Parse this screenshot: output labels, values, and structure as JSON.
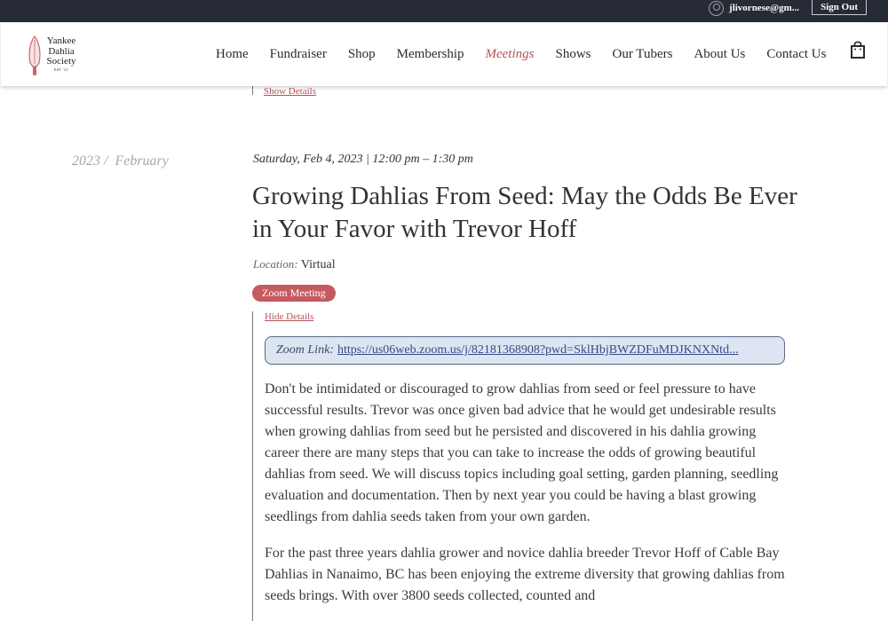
{
  "account": {
    "email": "jlivornese@gm...",
    "signout_label": "Sign Out"
  },
  "logo": {
    "line1": "Yankee",
    "line2": "Dahlia",
    "line3": "Society",
    "est": "EST '21"
  },
  "nav": {
    "items": [
      {
        "label": "Home"
      },
      {
        "label": "Fundraiser"
      },
      {
        "label": "Shop"
      },
      {
        "label": "Membership"
      },
      {
        "label": "Meetings",
        "active": true
      },
      {
        "label": "Shows"
      },
      {
        "label": "Our Tubers"
      },
      {
        "label": "About Us"
      },
      {
        "label": "Contact Us"
      }
    ]
  },
  "previous_event": {
    "show_details_label": "Show Details"
  },
  "event": {
    "side_year": "2023",
    "side_month": "February",
    "date_time": "Saturday, Feb 4, 2023 | 12:00 pm – 1:30 pm",
    "title": "Growing Dahlias From Seed: May the Odds Be Ever in Your Favor with Trevor Hoff",
    "location_label": "Location:",
    "location_value": "Virtual",
    "tag": "Zoom Meeting",
    "hide_details_label": "Hide Details",
    "zoom_label": "Zoom Link:",
    "zoom_url": "https://us06web.zoom.us/j/82181368908?pwd=SklHbjBWZDFuMDJKNXNtd...",
    "paragraph1": "Don't be intimidated or discouraged to grow dahlias from seed or feel pressure to have successful results. Trevor was once given bad advice that he would get undesirable results when growing dahlias from seed but he persisted and discovered in his dahlia growing career there are many steps that you can take to increase the odds of growing beautiful dahlias from seed. We will discuss topics including goal setting, garden planning, seedling evaluation and documentation. Then by next year you could be having a blast growing seedlings from dahlia seeds taken from your own garden.",
    "paragraph2": "For the past three years dahlia grower and novice dahlia breeder Trevor Hoff of Cable Bay Dahlias in Nanaimo, BC has been enjoying the extreme diversity that growing dahlias from seeds brings. With over 3800 seeds collected, counted and"
  },
  "colors": {
    "topbar": "#262b35",
    "accent": "#b4525a",
    "tag": "#c55a5f",
    "zoom_bg": "#dde4f2"
  },
  "icons": [
    "account-icon",
    "trowel-logo-icon",
    "shopping-bag-icon"
  ]
}
